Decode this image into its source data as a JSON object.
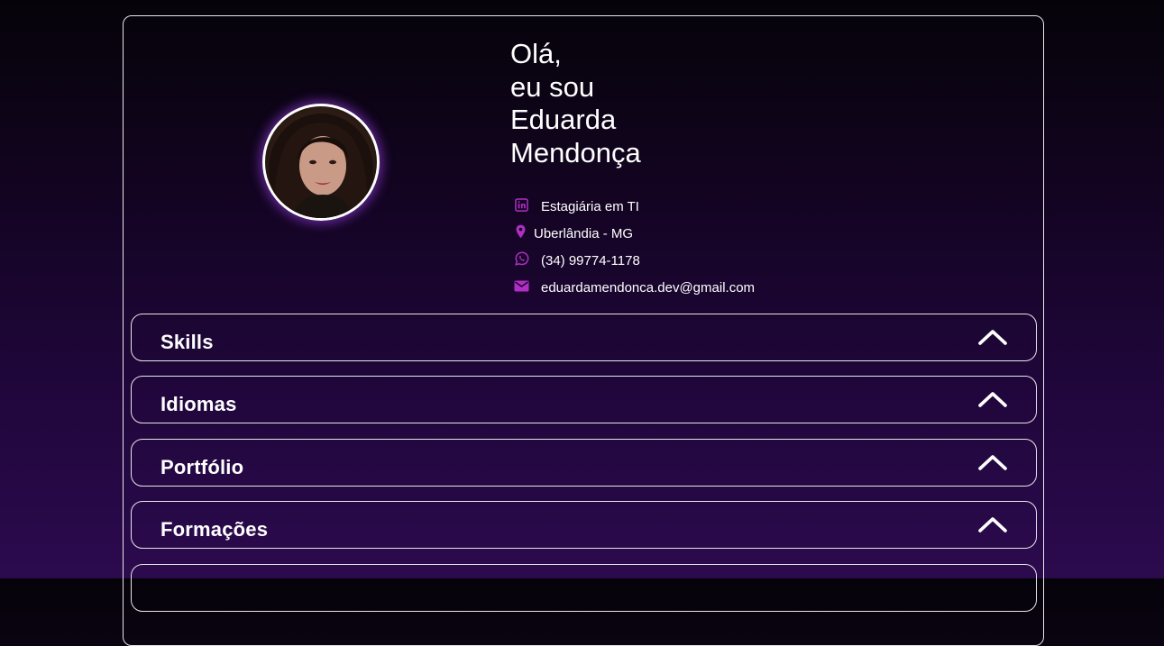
{
  "profile": {
    "greeting_lines": [
      "Olá,",
      "eu sou",
      "Eduarda",
      "Mendonça"
    ],
    "photo_alt": "profile photo"
  },
  "contacts": [
    {
      "icon": "linkedin-icon",
      "text": "Estagiária em TI"
    },
    {
      "icon": "location-pin-icon",
      "text": "Uberlândia - MG"
    },
    {
      "icon": "whatsapp-icon",
      "text": "(34) 99774-1178"
    },
    {
      "icon": "mail-icon",
      "text": "eduardamendonca.dev@gmail.com"
    }
  ],
  "sections": [
    {
      "title": "Skills",
      "icon": "chevron-up-icon"
    },
    {
      "title": "Idiomas",
      "icon": "chevron-up-icon"
    },
    {
      "title": "Portfólio",
      "icon": "chevron-up-icon"
    },
    {
      "title": "Formações",
      "icon": "chevron-up-icon"
    },
    {
      "title": "",
      "icon": "chevron-up-icon"
    }
  ],
  "colors": {
    "accent": "#b02ec4",
    "border": "#e6e6e6",
    "background_top": "#050309",
    "background_bottom": "#2c0a4e"
  }
}
